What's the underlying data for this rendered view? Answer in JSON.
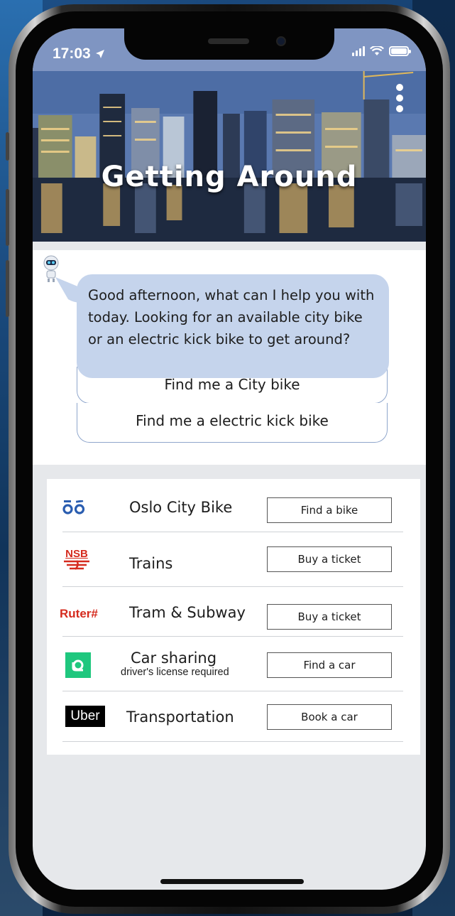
{
  "status": {
    "time": "17:03"
  },
  "hero": {
    "title": "Getting  Around"
  },
  "chat": {
    "message": "Good afternoon, what can I help you with today. Looking for an available city bike or an electric kick bike to get around?",
    "options": [
      "Find me a City bike",
      "Find me a electric kick bike"
    ]
  },
  "services": [
    {
      "logo": "oslo-city-bike-logo",
      "label": "Oslo City Bike",
      "action": "Find a bike"
    },
    {
      "logo": "nsb-logo",
      "logo_text": "NSB",
      "label": "Trains",
      "action": "Buy a ticket"
    },
    {
      "logo": "ruter-logo",
      "logo_text": "Ruter#",
      "label": "Tram & Subway",
      "action": "Buy a ticket"
    },
    {
      "logo": "car-sharing-logo",
      "label": "Car sharing",
      "sublabel": "driver's license required",
      "action": "Find a car"
    },
    {
      "logo": "uber-logo",
      "logo_text": "Uber",
      "label": "Transportation",
      "action": "Book a car"
    }
  ],
  "colors": {
    "status_bar": "#7f95c2",
    "chat_bubble": "#c5d4ec",
    "city_bike_blue": "#2a5db0",
    "nsb_red": "#d52b1e",
    "ruter_red": "#d52b1e",
    "car_sharing_green": "#1fc77e",
    "uber_black": "#000000"
  }
}
